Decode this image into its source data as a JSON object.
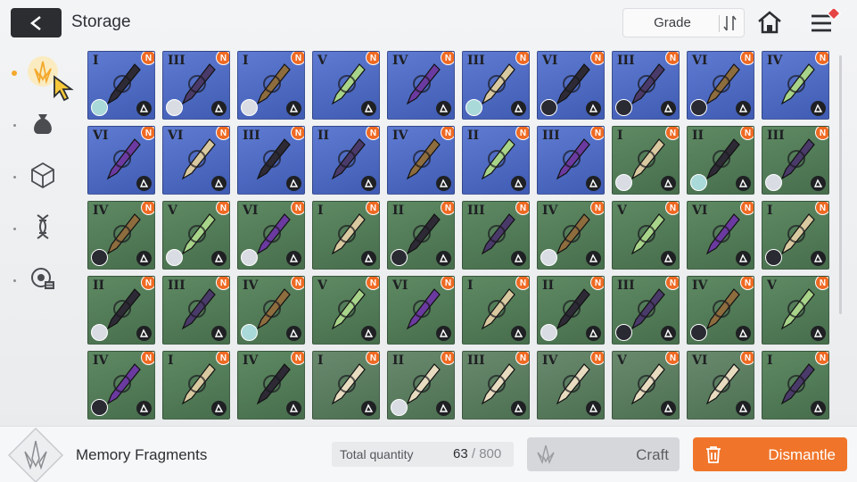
{
  "header": {
    "title": "Storage",
    "sort": {
      "label": "Grade"
    }
  },
  "sidebar": {
    "tabs": [
      {
        "icon": "memory-fragment-icon",
        "active": true
      },
      {
        "icon": "pouch-icon",
        "active": false
      },
      {
        "icon": "cube-icon",
        "active": false
      },
      {
        "icon": "helix-icon",
        "active": false
      },
      {
        "icon": "chip-icon",
        "active": false
      }
    ]
  },
  "items": [
    {
      "grade": "I",
      "bg": "blue",
      "avatar": "teal",
      "badge": "N"
    },
    {
      "grade": "III",
      "bg": "blue",
      "avatar": "light",
      "badge": "N"
    },
    {
      "grade": "I",
      "bg": "blue",
      "avatar": "light",
      "badge": "N"
    },
    {
      "grade": "V",
      "bg": "blue",
      "avatar": "none",
      "badge": "N"
    },
    {
      "grade": "IV",
      "bg": "blue",
      "avatar": "none",
      "badge": "N"
    },
    {
      "grade": "III",
      "bg": "blue",
      "avatar": "teal",
      "badge": "N"
    },
    {
      "grade": "VI",
      "bg": "blue",
      "avatar": "dark",
      "badge": "N"
    },
    {
      "grade": "III",
      "bg": "blue",
      "avatar": "dark",
      "badge": "N"
    },
    {
      "grade": "VI",
      "bg": "blue",
      "avatar": "dark",
      "badge": "N"
    },
    {
      "grade": "IV",
      "bg": "blue",
      "avatar": "none",
      "badge": "N"
    },
    {
      "grade": "VI",
      "bg": "blue",
      "avatar": "none",
      "badge": "N"
    },
    {
      "grade": "VI",
      "bg": "blue",
      "avatar": "none",
      "badge": "N"
    },
    {
      "grade": "III",
      "bg": "blue",
      "avatar": "none",
      "badge": "N"
    },
    {
      "grade": "II",
      "bg": "blue",
      "avatar": "none",
      "badge": "N"
    },
    {
      "grade": "IV",
      "bg": "blue",
      "avatar": "none",
      "badge": "N"
    },
    {
      "grade": "II",
      "bg": "blue",
      "avatar": "none",
      "badge": "N"
    },
    {
      "grade": "III",
      "bg": "blue",
      "avatar": "none",
      "badge": "N"
    },
    {
      "grade": "I",
      "bg": "green",
      "avatar": "light",
      "badge": "N"
    },
    {
      "grade": "II",
      "bg": "green",
      "avatar": "teal",
      "badge": "N"
    },
    {
      "grade": "III",
      "bg": "green",
      "avatar": "light",
      "badge": "N"
    },
    {
      "grade": "IV",
      "bg": "green",
      "avatar": "dark",
      "badge": "N"
    },
    {
      "grade": "V",
      "bg": "green",
      "avatar": "light",
      "badge": "N"
    },
    {
      "grade": "VI",
      "bg": "green",
      "avatar": "light",
      "badge": "N"
    },
    {
      "grade": "I",
      "bg": "green",
      "avatar": "none",
      "badge": "N"
    },
    {
      "grade": "II",
      "bg": "green",
      "avatar": "dark",
      "badge": "N"
    },
    {
      "grade": "III",
      "bg": "green",
      "avatar": "none",
      "badge": "N"
    },
    {
      "grade": "IV",
      "bg": "green",
      "avatar": "light",
      "badge": "N"
    },
    {
      "grade": "V",
      "bg": "green",
      "avatar": "none",
      "badge": "N"
    },
    {
      "grade": "VI",
      "bg": "green",
      "avatar": "none",
      "badge": "N"
    },
    {
      "grade": "I",
      "bg": "green",
      "avatar": "dark",
      "badge": "N"
    },
    {
      "grade": "II",
      "bg": "green",
      "avatar": "light",
      "badge": "N"
    },
    {
      "grade": "III",
      "bg": "green",
      "avatar": "none",
      "badge": "N"
    },
    {
      "grade": "IV",
      "bg": "green",
      "avatar": "teal",
      "badge": "N"
    },
    {
      "grade": "V",
      "bg": "green",
      "avatar": "none",
      "badge": "N"
    },
    {
      "grade": "VI",
      "bg": "green",
      "avatar": "none",
      "badge": "N"
    },
    {
      "grade": "I",
      "bg": "green",
      "avatar": "none",
      "badge": "N"
    },
    {
      "grade": "II",
      "bg": "green",
      "avatar": "light",
      "badge": "N"
    },
    {
      "grade": "III",
      "bg": "green",
      "avatar": "dark",
      "badge": "N"
    },
    {
      "grade": "IV",
      "bg": "green",
      "avatar": "dark",
      "badge": "N"
    },
    {
      "grade": "V",
      "bg": "green",
      "avatar": "none",
      "badge": "N"
    },
    {
      "grade": "IV",
      "bg": "green",
      "avatar": "dark",
      "badge": "N"
    },
    {
      "grade": "I",
      "bg": "green",
      "avatar": "none",
      "badge": "N"
    },
    {
      "grade": "IV",
      "bg": "green",
      "avatar": "none",
      "badge": "N"
    },
    {
      "grade": "I",
      "bg": "gold",
      "avatar": "none",
      "badge": "N"
    },
    {
      "grade": "II",
      "bg": "gold",
      "avatar": "light",
      "badge": "N"
    },
    {
      "grade": "III",
      "bg": "gold",
      "avatar": "none",
      "badge": "N"
    },
    {
      "grade": "IV",
      "bg": "gold",
      "avatar": "none",
      "badge": "N"
    },
    {
      "grade": "V",
      "bg": "gold",
      "avatar": "none",
      "badge": "N"
    },
    {
      "grade": "VI",
      "bg": "gold",
      "avatar": "none",
      "badge": "N"
    },
    {
      "grade": "I",
      "bg": "green",
      "avatar": "none",
      "badge": "N"
    }
  ],
  "footer": {
    "label": "Memory Fragments",
    "total_label": "Total quantity",
    "total_value": "63",
    "total_sep": " / ",
    "total_max": "800",
    "craft_label": "Craft",
    "dismantle_label": "Dismantle"
  },
  "colors": {
    "accent": "#f0752a",
    "blue_card": "#4f6bc2",
    "green_card": "#527a57",
    "badge": "#ef6a23"
  }
}
